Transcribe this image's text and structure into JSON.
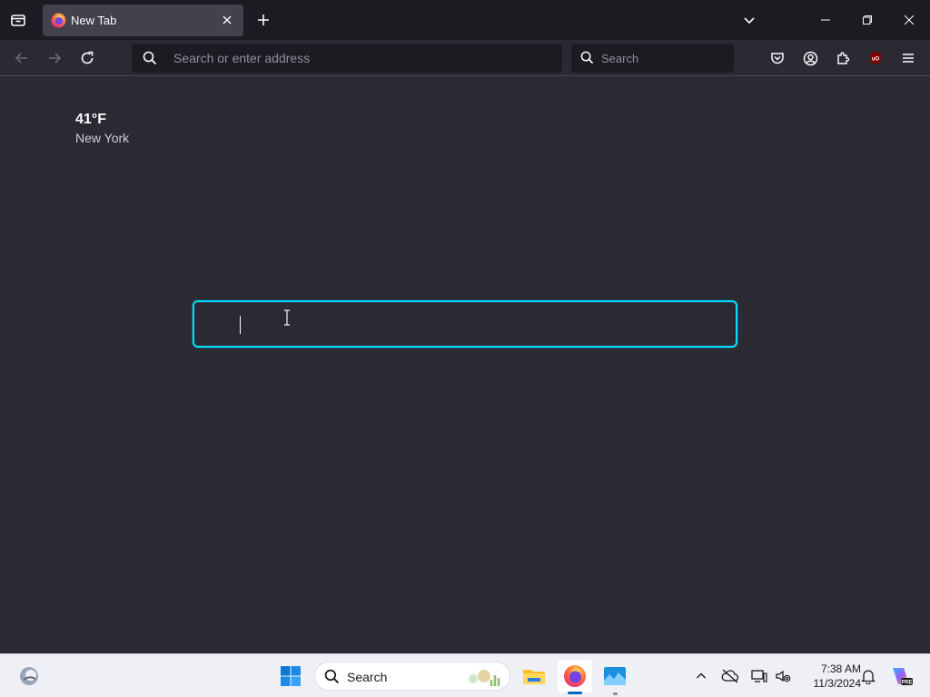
{
  "tab": {
    "title": "New Tab"
  },
  "urlbar": {
    "placeholder": "Search or enter address"
  },
  "searchbar": {
    "placeholder": "Search"
  },
  "weather": {
    "temperature": "41°F",
    "location": "New York"
  },
  "content_search": {
    "value": ""
  },
  "taskbar": {
    "search_label": "Search",
    "clock_time": "7:38 AM",
    "clock_date": "11/3/2024"
  },
  "icons": {
    "tab_tray": "tab-tray-icon",
    "favicon": "firefox-icon",
    "close": "close-icon",
    "new_tab": "plus-icon",
    "tab_list": "chevron-down-icon",
    "back": "arrow-left-icon",
    "forward": "arrow-right-icon",
    "reload": "reload-icon",
    "pocket": "pocket-icon",
    "account": "account-icon",
    "extensions": "puzzle-icon",
    "ublock": "ublock-origin-icon",
    "menu": "hamburger-icon"
  },
  "colors": {
    "accent": "#00ddff",
    "background": "#2b2a33",
    "toolbar": "#1c1b22",
    "tab_active": "#42414d",
    "taskbar": "#eef0f5"
  }
}
